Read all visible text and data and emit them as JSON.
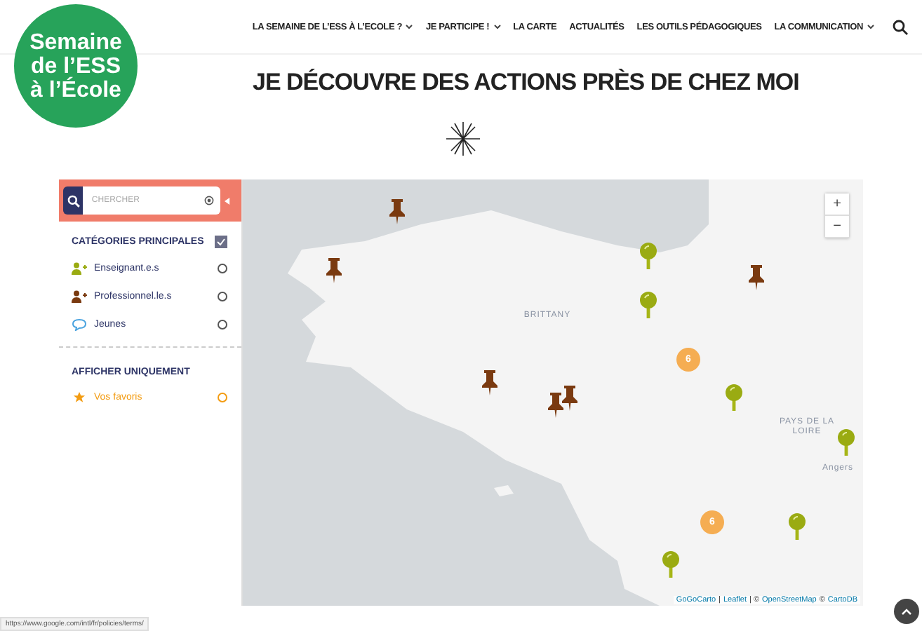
{
  "logo": {
    "lines": [
      "Semaine",
      "de l’ESS",
      "à l’École"
    ]
  },
  "nav": [
    {
      "label": "LA SEMAINE DE L’ESS À L’ECOLE ?",
      "dropdown": true
    },
    {
      "label": "JE PARTICIPE !",
      "dropdown": true
    },
    {
      "label": "LA CARTE",
      "dropdown": false
    },
    {
      "label": "ACTUALITÉS",
      "dropdown": false
    },
    {
      "label": "LES OUTILS PÉDAGOGIQUES",
      "dropdown": false
    },
    {
      "label": "LA COMMUNICATION",
      "dropdown": true
    }
  ],
  "page_title": "JE DÉCOUVRE DES ACTIONS PRÈS DE CHEZ MOI",
  "map": {
    "search": {
      "placeholder": "CHERCHER"
    },
    "categories": {
      "title": "CATÉGORIES PRINCIPALES",
      "checked": true,
      "items": [
        {
          "label": "Enseignant.e.s",
          "kind": "person",
          "color": "#9aab12",
          "selected": false
        },
        {
          "label": "Professionnel.le.s",
          "kind": "person",
          "color": "#7a3a10",
          "selected": false
        },
        {
          "label": "Jeunes",
          "kind": "bubble",
          "color": "#4aa3df",
          "selected": false
        }
      ]
    },
    "filter": {
      "title": "AFFICHER UNIQUEMENT",
      "items": [
        {
          "label": "Vos favoris",
          "selected": false
        }
      ]
    },
    "labels": [
      "BRITTANY",
      "PAYS DE LA LOIRE",
      "Angers"
    ],
    "markers": [
      {
        "kind": "pushpin"
      },
      {
        "kind": "pushpin"
      },
      {
        "kind": "pushpin"
      },
      {
        "kind": "pushpin"
      },
      {
        "kind": "pushpin"
      },
      {
        "kind": "pushpin"
      },
      {
        "kind": "pin"
      },
      {
        "kind": "pin"
      },
      {
        "kind": "pin"
      },
      {
        "kind": "pin"
      },
      {
        "kind": "pin"
      },
      {
        "kind": "pin"
      },
      {
        "kind": "cluster",
        "count": "6"
      },
      {
        "kind": "cluster",
        "count": "6"
      }
    ],
    "zoom": [
      "+",
      "−"
    ],
    "attribution": [
      {
        "text": "GoGoCarto",
        "kind": "link"
      },
      {
        "text": "|",
        "kind": "text"
      },
      {
        "text": "Leaflet",
        "kind": "link"
      },
      {
        "text": "| ©",
        "kind": "text"
      },
      {
        "text": "OpenStreetMap",
        "kind": "link"
      },
      {
        "text": "©",
        "kind": "text"
      },
      {
        "text": "CartoDB",
        "kind": "link"
      }
    ]
  },
  "status_url": "https://www.google.com/intl/fr/policies/terms/"
}
